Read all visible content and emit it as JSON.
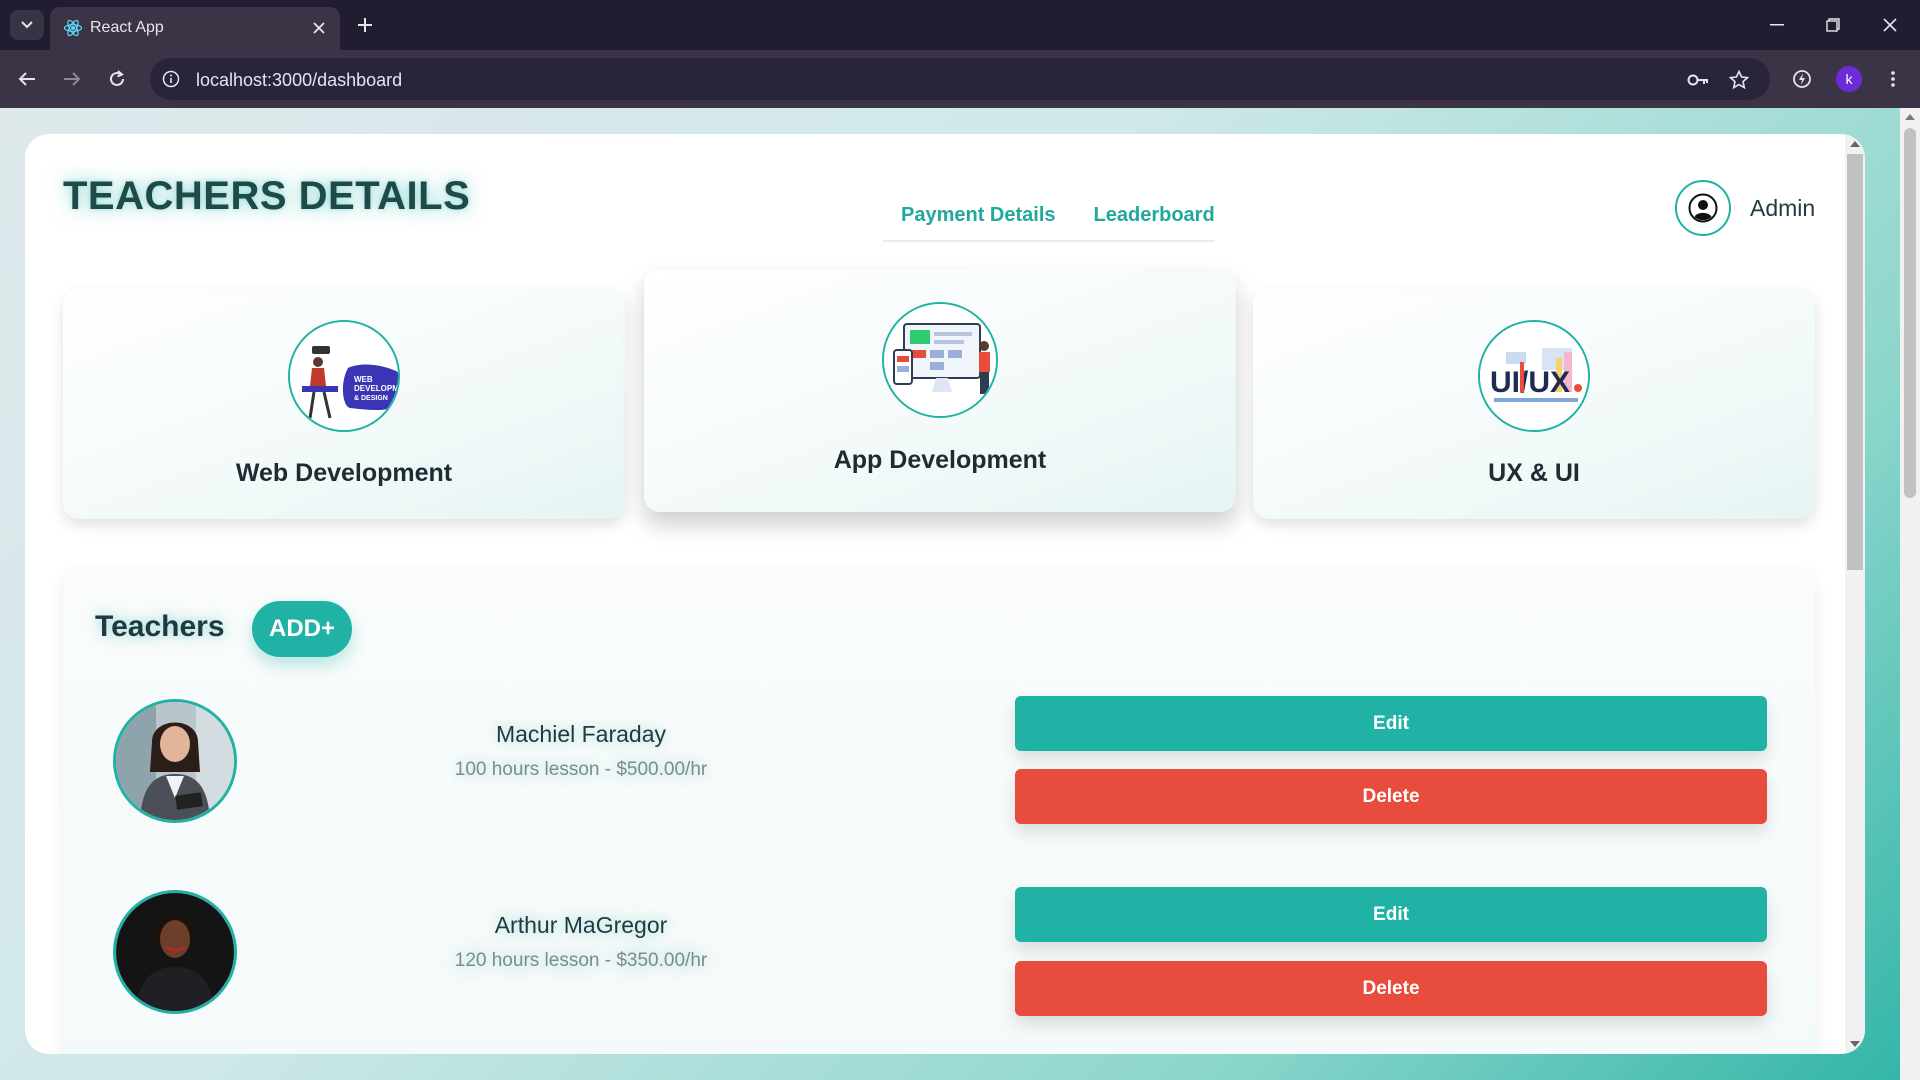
{
  "browser": {
    "tab_title": "React App",
    "url": "localhost:3000/dashboard",
    "profile_initial": "k"
  },
  "header": {
    "title": "TEACHERS DETAILS",
    "links": [
      "Payment Details",
      "Leaderboard"
    ],
    "user_label": "Admin"
  },
  "courses": [
    {
      "label": "Web Development",
      "image_text": "WEB DEVELOPMENT & DESIGN"
    },
    {
      "label": "App Development"
    },
    {
      "label": "UX & UI",
      "image_text": "UI/UX"
    }
  ],
  "teachers_section": {
    "heading": "Teachers",
    "add_label": "ADD+",
    "edit_label": "Edit",
    "delete_label": "Delete",
    "teachers": [
      {
        "name": "Machiel Faraday",
        "details": "100 hours lesson - $500.00/hr"
      },
      {
        "name": "Arthur MaGregor",
        "details": "120 hours lesson - $350.00/hr"
      }
    ]
  },
  "colors": {
    "accent": "#20b2a4",
    "danger": "#e74c3c",
    "title": "#1f4a4a"
  }
}
